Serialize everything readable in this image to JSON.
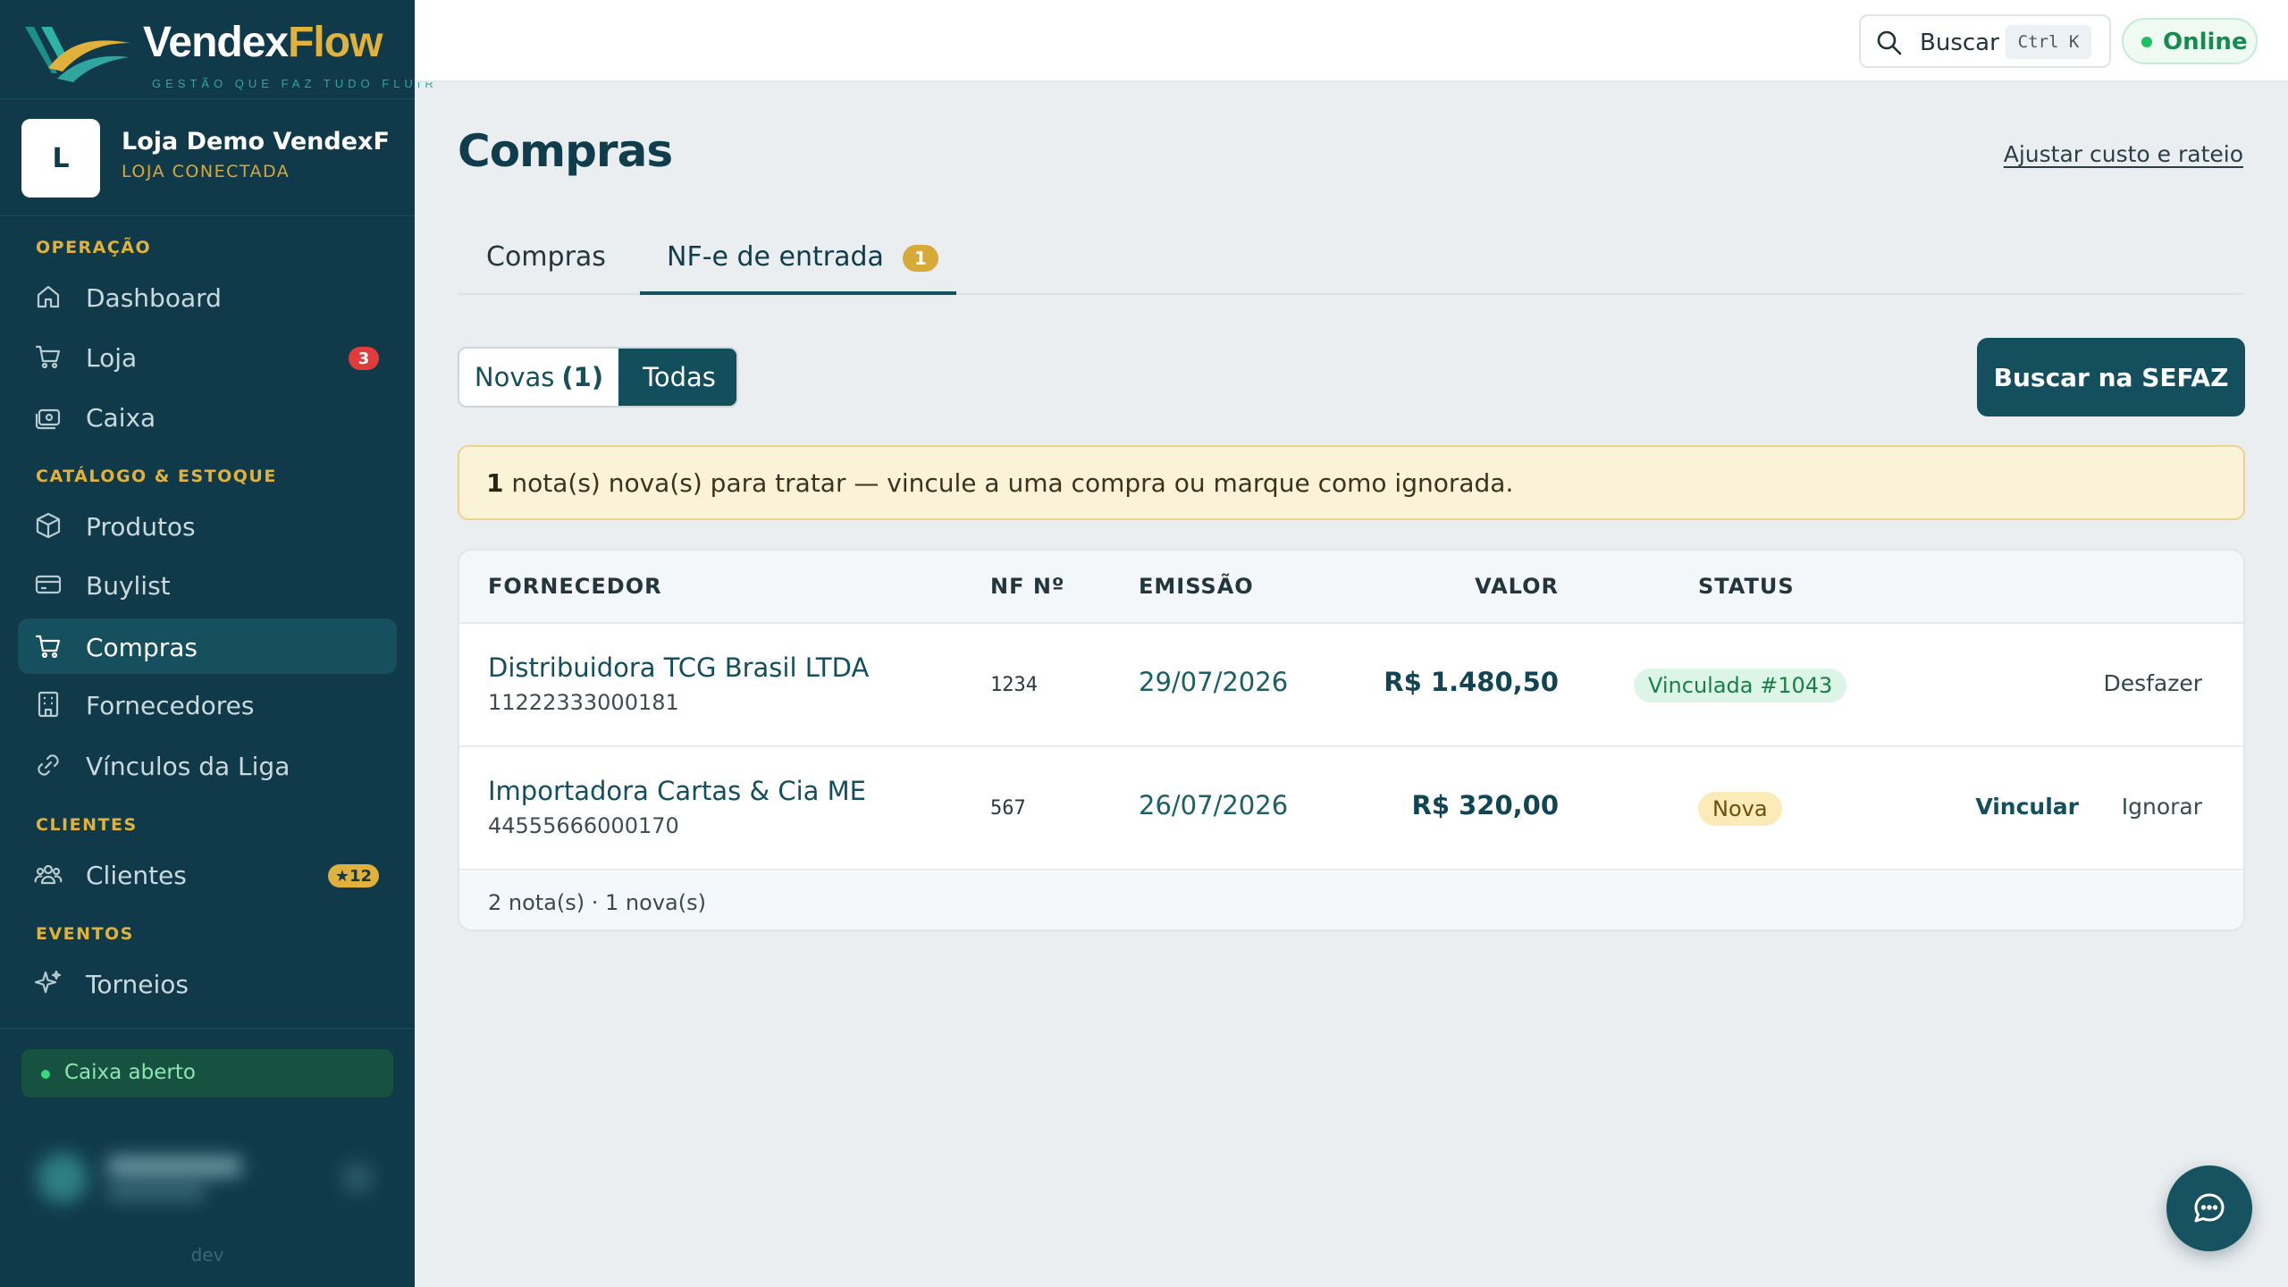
{
  "brand": {
    "name_part1": "Vendex",
    "name_part2": "Flow",
    "tagline": "GESTÃO QUE FAZ TUDO FLUIR"
  },
  "store": {
    "initial": "L",
    "name": "Loja Demo VendexFl...",
    "status": "LOJA CONECTADA"
  },
  "sidebar": {
    "sections": {
      "operacao": "OPERAÇÃO",
      "catalogo": "CATÁLOGO & ESTOQUE",
      "clientes": "CLIENTES",
      "eventos": "EVENTOS"
    },
    "items": [
      {
        "label": "Dashboard",
        "icon": "home-icon"
      },
      {
        "label": "Loja",
        "icon": "cart-icon",
        "badge": "3"
      },
      {
        "label": "Caixa",
        "icon": "cash-register-icon"
      },
      {
        "label": "Produtos",
        "icon": "box-icon"
      },
      {
        "label": "Buylist",
        "icon": "card-icon"
      },
      {
        "label": "Compras",
        "icon": "cart-icon",
        "active": true
      },
      {
        "label": "Fornecedores",
        "icon": "building-icon"
      },
      {
        "label": "Vínculos da Liga",
        "icon": "link-icon"
      },
      {
        "label": "Clientes",
        "icon": "users-icon",
        "badge": "★12"
      },
      {
        "label": "Torneios",
        "icon": "sparkle-icon"
      }
    ],
    "cash_status": "Caixa aberto",
    "env": "dev"
  },
  "topbar": {
    "search_label": "Buscar",
    "search_shortcut": "Ctrl K",
    "online_label": "Online"
  },
  "page": {
    "title": "Compras",
    "adjust_link": "Ajustar custo e rateio",
    "tabs": [
      {
        "label": "Compras"
      },
      {
        "label": "NF-e de entrada",
        "count": "1"
      }
    ],
    "filter": {
      "novas_label": "Novas",
      "novas_count": "(1)",
      "todas_label": "Todas"
    },
    "sefaz_button": "Buscar na SEFAZ",
    "alert": {
      "count": "1",
      "text": " nota(s) nova(s) para tratar — vincule a uma compra ou marque como ignorada."
    },
    "table": {
      "headers": {
        "supplier": "FORNECEDOR",
        "nf": "NF Nº",
        "date": "EMISSÃO",
        "value": "VALOR",
        "status": "STATUS"
      },
      "rows": [
        {
          "supplier": "Distribuidora TCG Brasil LTDA",
          "cnpj": "11222333000181",
          "nf": "1234",
          "date": "29/07/2026",
          "value": "R$ 1.480,50",
          "status": "Vinculada #1043",
          "action": "Desfazer"
        },
        {
          "supplier": "Importadora Cartas & Cia ME",
          "cnpj": "44555666000170",
          "nf": "567",
          "date": "26/07/2026",
          "value": "R$ 320,00",
          "status": "Nova",
          "action_link": "Vincular",
          "action_ignore": "Ignorar"
        }
      ],
      "footer": "2 nota(s) · 1 nova(s)"
    }
  },
  "colors": {
    "sidebar_bg": "#103a4a",
    "accent": "#134f5d",
    "gold": "#e0b23c",
    "success": "#1fbf64"
  }
}
